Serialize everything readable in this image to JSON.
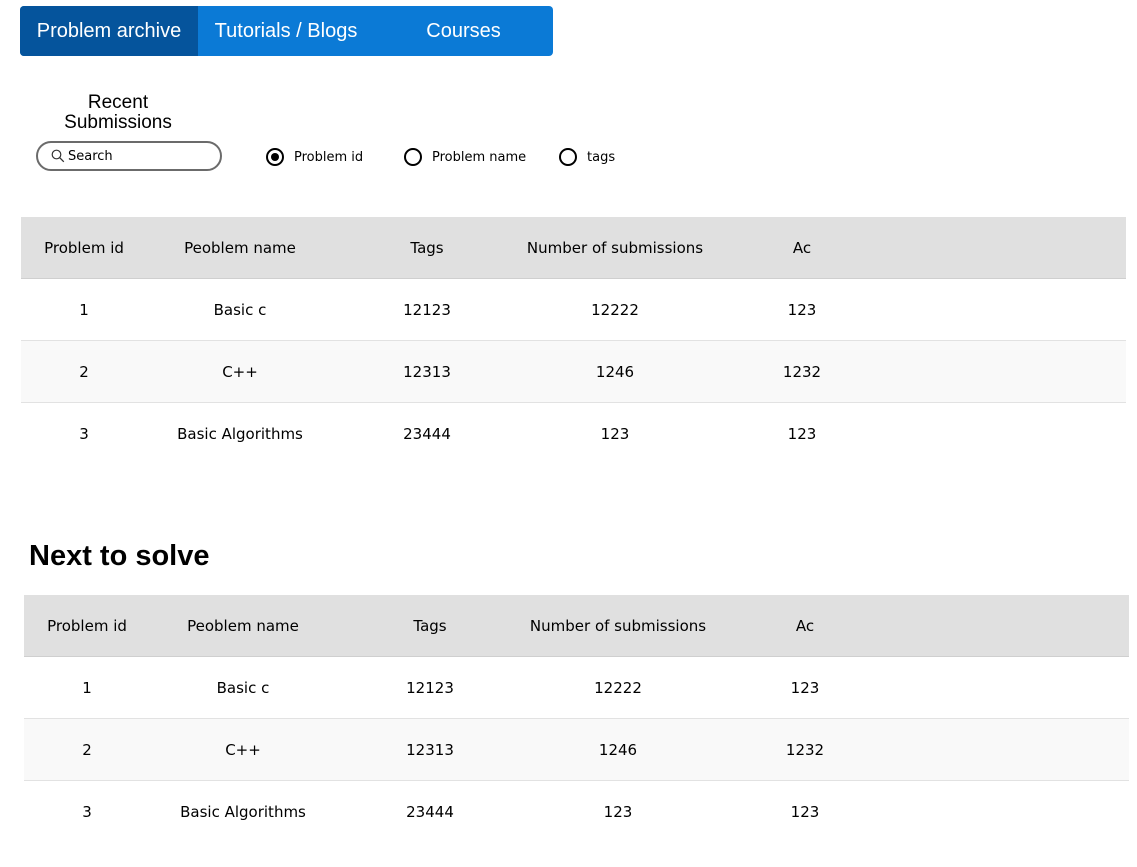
{
  "nav": {
    "tabs": [
      {
        "label": "Problem archive",
        "active": true
      },
      {
        "label": "Tutorials / Blogs",
        "active": false
      },
      {
        "label": "Courses",
        "active": false
      }
    ]
  },
  "recent": {
    "title": "Recent Submissions",
    "search": {
      "placeholder": "Search",
      "value": ""
    },
    "filter_options": [
      {
        "label": "Problem id",
        "checked": true
      },
      {
        "label": "Problem name",
        "checked": false
      },
      {
        "label": "tags",
        "checked": false
      }
    ],
    "table": {
      "headers": [
        "Problem id",
        "Peoblem name",
        "Tags",
        "Number of submissions",
        "Ac"
      ],
      "rows": [
        [
          "1",
          "Basic c",
          "12123",
          "12222",
          "123"
        ],
        [
          "2",
          "C++",
          "12313",
          "1246",
          "1232"
        ],
        [
          "3",
          "Basic Algorithms",
          "23444",
          "123",
          "123"
        ]
      ]
    }
  },
  "next": {
    "title": "Next to solve",
    "table": {
      "headers": [
        "Problem id",
        "Peoblem name",
        "Tags",
        "Number of submissions",
        "Ac"
      ],
      "rows": [
        [
          "1",
          "Basic c",
          "12123",
          "12222",
          "123"
        ],
        [
          "2",
          "C++",
          "12313",
          "1246",
          "1232"
        ],
        [
          "3",
          "Basic Algorithms",
          "23444",
          "123",
          "123"
        ]
      ]
    }
  },
  "colors": {
    "nav_bg": "#0b7ad6",
    "nav_active": "#05549c",
    "table_header_bg": "#e0e0e0",
    "row_alt_bg": "#f9f9f9"
  },
  "icons": {
    "search": "search-icon"
  }
}
